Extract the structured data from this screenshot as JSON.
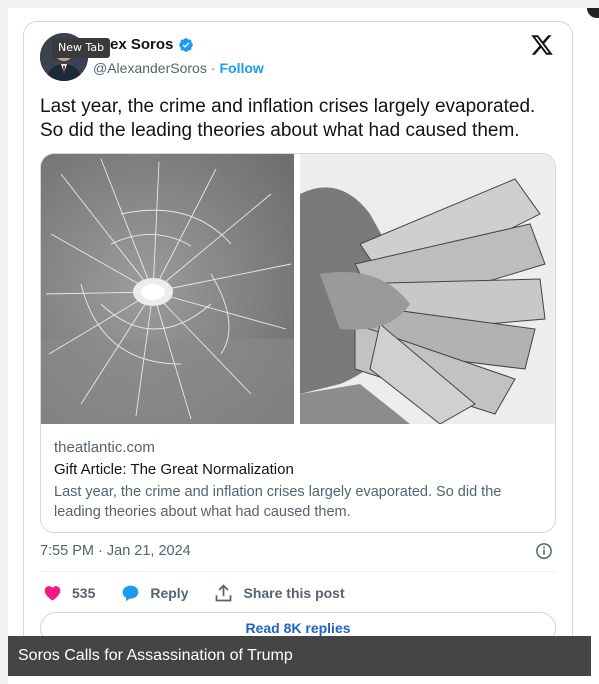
{
  "tooltip": {
    "label": "New Tab"
  },
  "author": {
    "display_name_visible": "ex Soros",
    "handle": "@AlexanderSoros",
    "separator": "·",
    "follow_label": "Follow",
    "verified_icon": "verified-badge-icon"
  },
  "platform_icon": "x-logo-icon",
  "tweet": {
    "text_line1": "Last year, the crime and inflation crises largely evaporated.",
    "text_line2": "So did the leading theories about what had caused them."
  },
  "link_card": {
    "images": [
      "shattered-glass-image",
      "dollar-bills-image"
    ],
    "domain": "theatlantic.com",
    "title": "Gift Article: The Great Normalization",
    "description": "Last year, the crime and inflation crises largely evaporated. So did the leading theories about what had caused them."
  },
  "meta": {
    "timestamp": "7:55 PM · Jan 21, 2024",
    "info_icon": "info-icon"
  },
  "actions": {
    "like_count": "535",
    "reply_label": "Reply",
    "share_label": "Share this post"
  },
  "read_replies_label": "Read 8K replies",
  "caption": "Soros Calls for Assassination of Trump",
  "colors": {
    "accent_blue": "#1d9bf0",
    "like_pink": "#f91880",
    "muted_text": "#536471",
    "caption_bg": "#373737"
  }
}
